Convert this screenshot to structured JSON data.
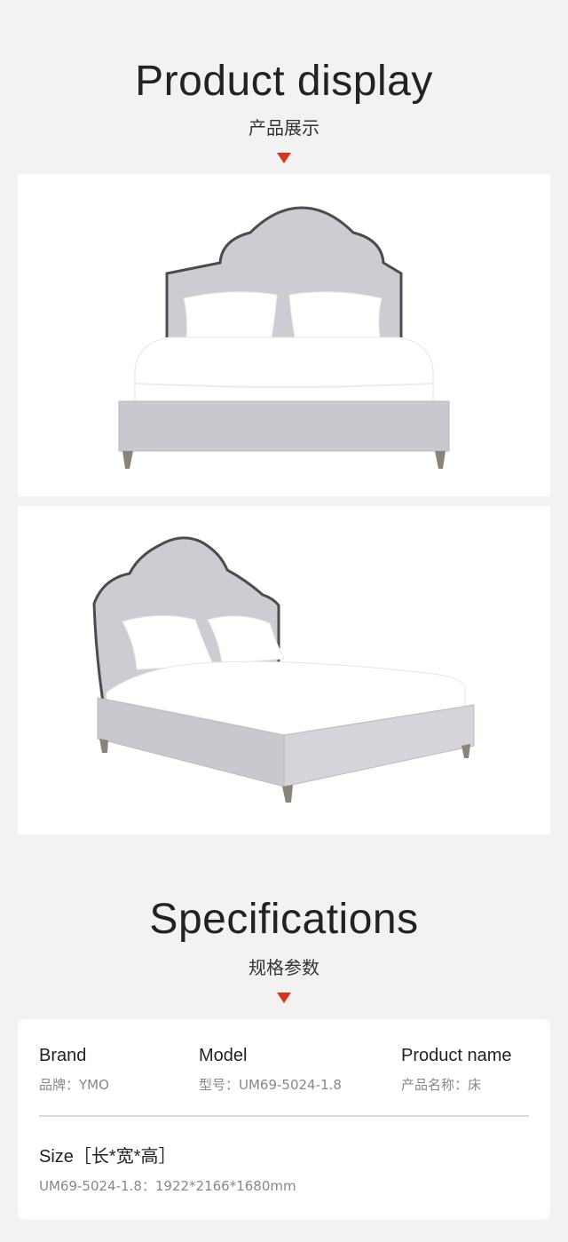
{
  "display": {
    "title": "Product display",
    "subtitle": "产品展示"
  },
  "specifications": {
    "title": "Specifications",
    "subtitle": "规格参数",
    "brand": {
      "label": "Brand",
      "value": "品牌：YMO"
    },
    "model": {
      "label": "Model",
      "value": "型号：UM69-5024-1.8"
    },
    "product_name": {
      "label": "Product name",
      "value": "产品名称：床"
    },
    "size": {
      "label": "Size［长*宽*高］",
      "value": "UM69-5024-1.8：1922*2166*1680mm"
    }
  },
  "colors": {
    "accent": "#d8331f",
    "background": "#f2f2f2",
    "upholstery": "#cfcbd3",
    "piping": "#4d4a50"
  }
}
